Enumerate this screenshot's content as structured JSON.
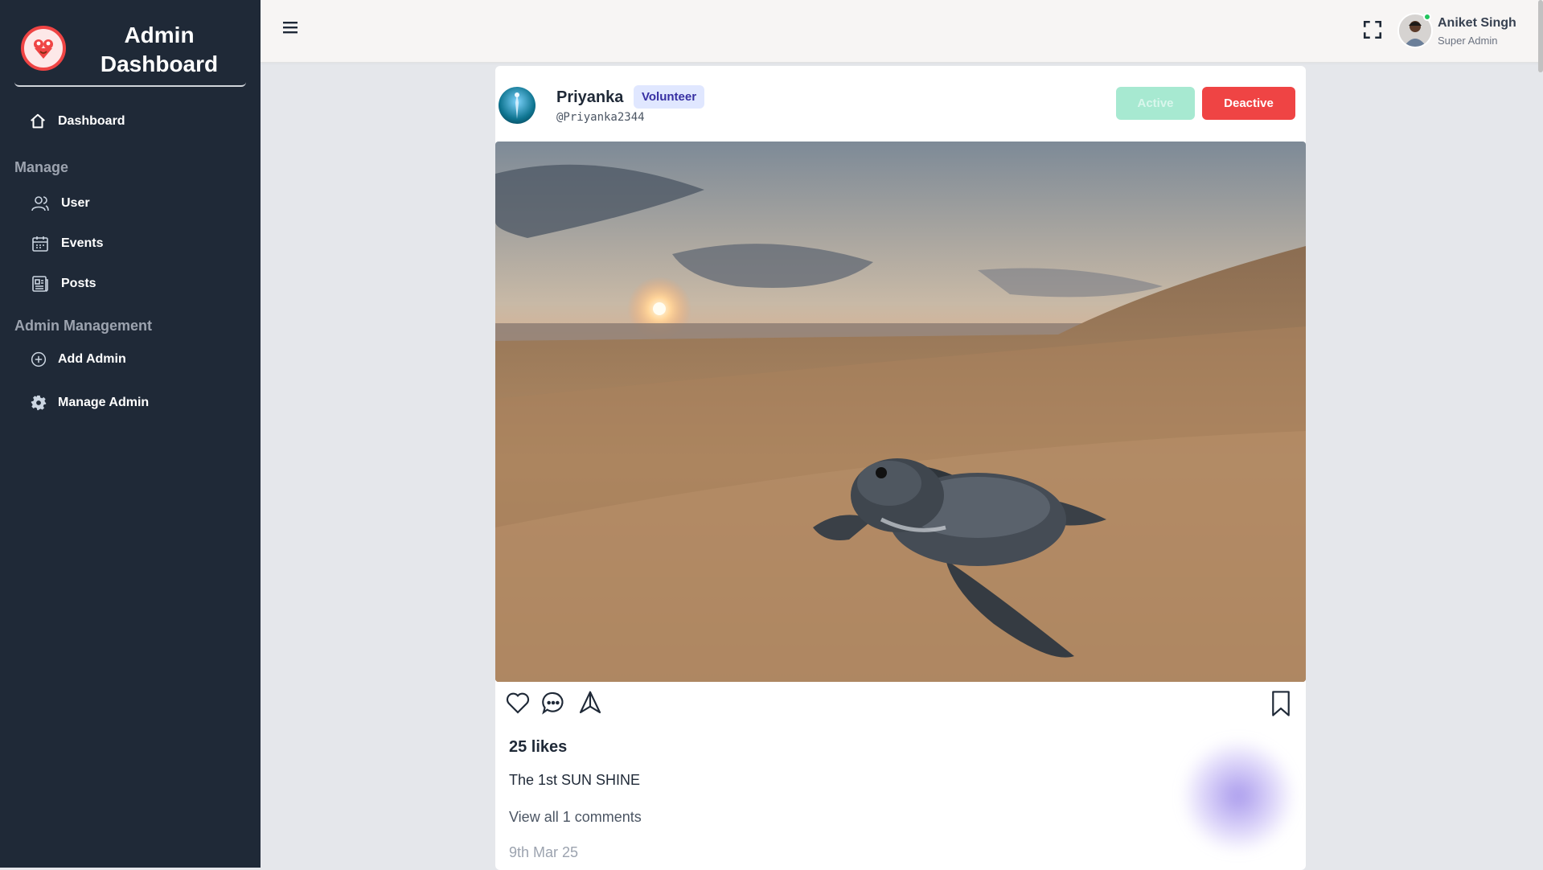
{
  "sidebar": {
    "brand_title": "Admin Dashboard",
    "dashboard_label": "Dashboard",
    "manage_title": "Manage",
    "manage_items": [
      {
        "label": "User",
        "icon": "users-icon"
      },
      {
        "label": "Events",
        "icon": "calendar-icon"
      },
      {
        "label": "Posts",
        "icon": "newspaper-icon"
      }
    ],
    "admin_title": "Admin Management",
    "admin_items": [
      {
        "label": "Add Admin",
        "icon": "plus-circle-icon"
      },
      {
        "label": "Manage Admin",
        "icon": "gear-icon"
      }
    ]
  },
  "header": {
    "user_name": "Aniket Singh",
    "user_role": "Super Admin"
  },
  "post": {
    "author_name": "Priyanka",
    "author_role": "Volunteer",
    "author_handle": "@Priyanka2344",
    "active_label": "Active",
    "deactive_label": "Deactive",
    "likes": "25 likes",
    "caption": "The 1st SUN SHINE",
    "comments_link": "View all 1 comments",
    "date": "9th Mar 25"
  },
  "colors": {
    "sidebar_bg": "#1f2937",
    "deactive": "#ef4444",
    "active": "#a7e9d1",
    "badge_bg": "#e0e7ff",
    "online": "#22c55e"
  }
}
